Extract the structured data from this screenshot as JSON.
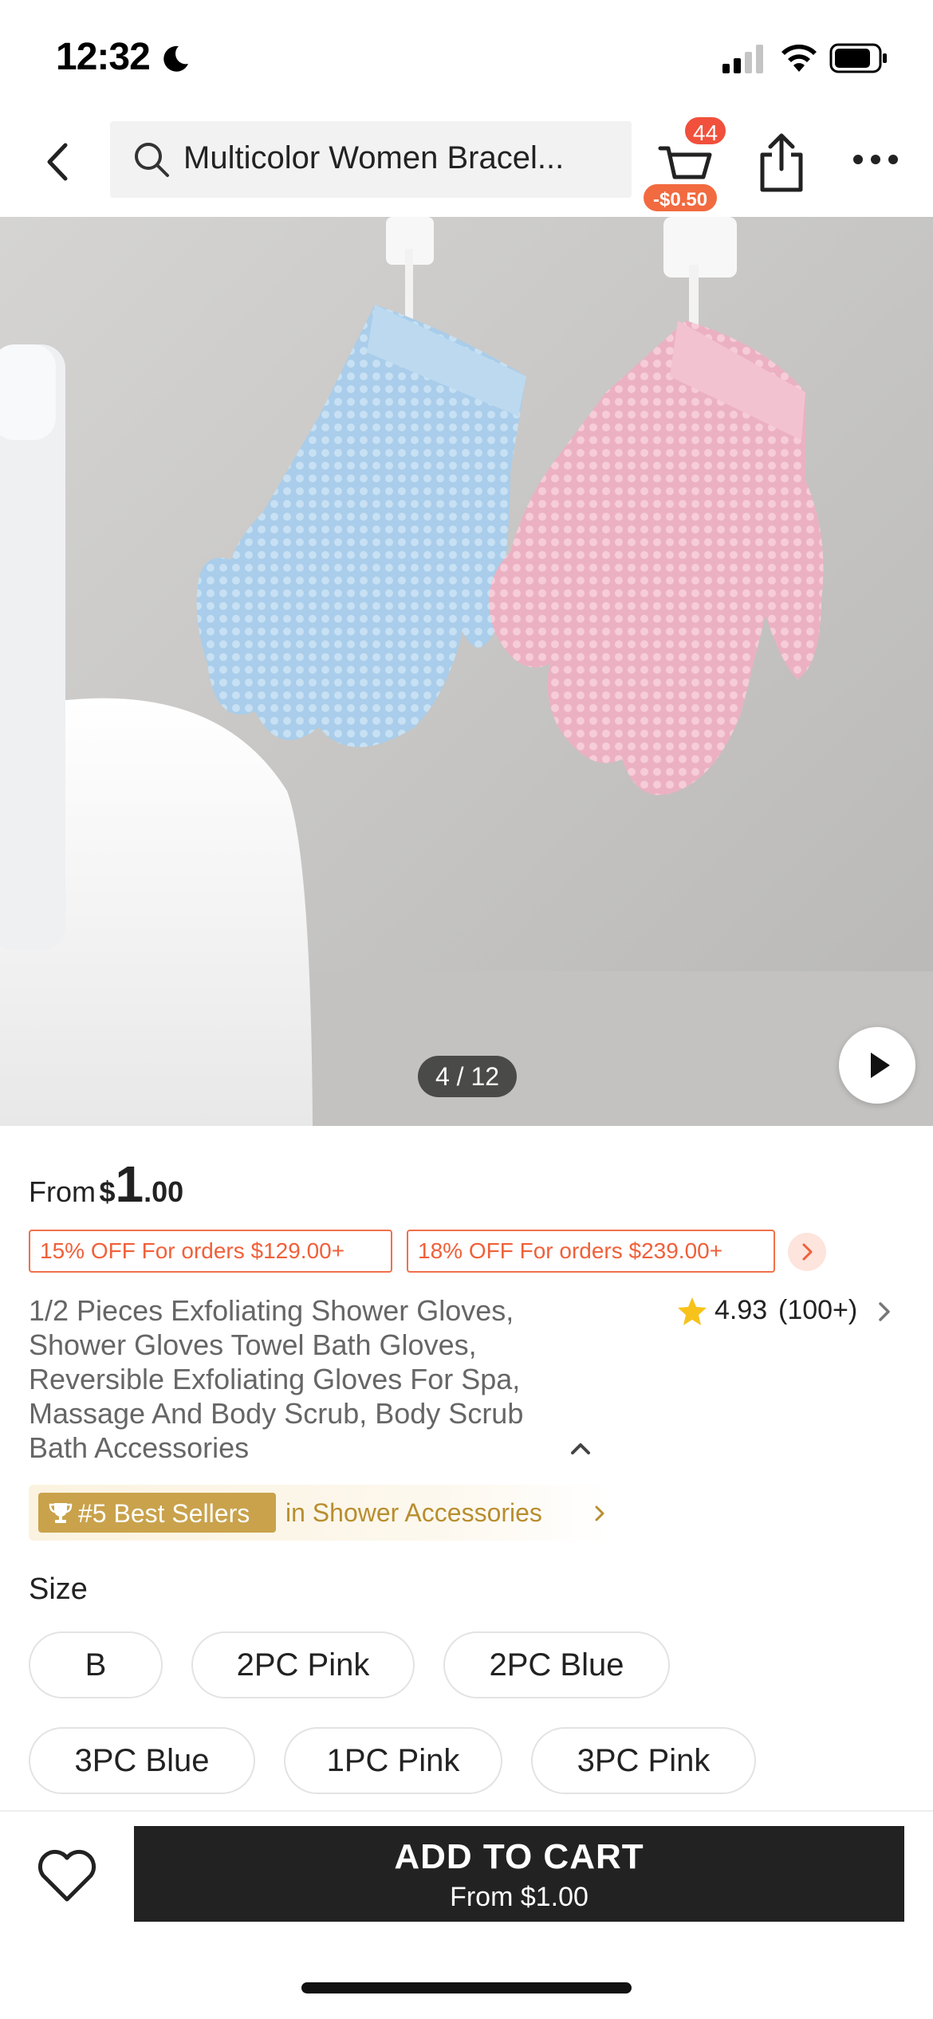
{
  "status_bar": {
    "time": "12:32",
    "icons": [
      "moon-icon",
      "cellular-signal-icon",
      "wifi-icon",
      "battery-icon"
    ]
  },
  "nav": {
    "back_icon": "chevron-left-icon",
    "search_text": "Multicolor Women Bracel...",
    "cart_count": "44",
    "cart_promo": "-$0.50",
    "share_icon": "share-icon",
    "more_icon": "more-horizontal-icon"
  },
  "gallery": {
    "counter": "4 / 12",
    "current_index": 4,
    "total": 12,
    "play_icon": "play-icon"
  },
  "price": {
    "from_label": "From",
    "currency": "$",
    "integer": "1",
    "decimal": ".00"
  },
  "coupons": [
    "15% OFF For orders $129.00+",
    "18% OFF For orders $239.00+"
  ],
  "product": {
    "title": "1/2 Pieces Exfoliating Shower Gloves, Shower Gloves Towel Bath Gloves, Reversible Exfoliating Gloves For Spa, Massage And Body Scrub, Body Scrub Bath Accessories",
    "rating": "4.93",
    "review_count": "(100+)"
  },
  "bestseller": {
    "rank": "#5 Best Sellers",
    "category": "in Shower Accessories"
  },
  "size": {
    "label": "Size",
    "options": [
      "B",
      "2PC Pink",
      "2PC Blue",
      "3PC Blue",
      "1PC Pink",
      "3PC Pink"
    ]
  },
  "bottom_bar": {
    "add_to_cart_label": "ADD TO CART",
    "add_to_cart_sub": "From  $1.00"
  },
  "colors": {
    "accent": "#f0603a",
    "badge": "#f0503c",
    "gold": "#c9a24b",
    "button_dark": "#222222"
  }
}
